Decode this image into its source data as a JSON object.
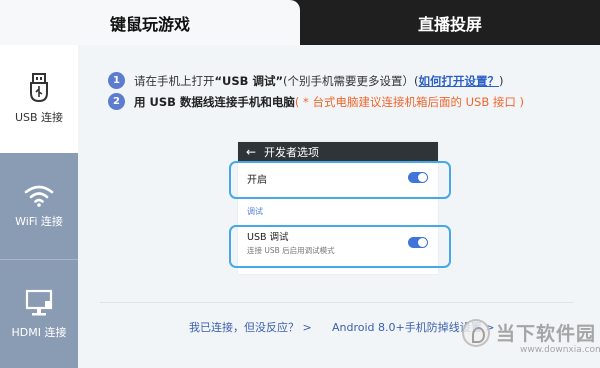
{
  "tabs": {
    "keyboard_mouse": "键鼠玩游戏",
    "screen_cast": "直播投屏"
  },
  "sidebar": {
    "items": [
      {
        "label": "USB 连接",
        "icon": "usb-icon"
      },
      {
        "label": "WiFi 连接",
        "icon": "wifi-icon"
      },
      {
        "label": "HDMI 连接",
        "icon": "monitor-icon"
      }
    ]
  },
  "steps": {
    "step1": {
      "number": "1",
      "text_a": "请在手机上打开",
      "text_b": "“USB 调试”",
      "text_c": "(个别手机需要更多设置）(",
      "link": "如何打开设置？",
      "text_d": ")"
    },
    "step2": {
      "number": "2",
      "text_a": "用 USB 数据线连接手机和电脑",
      "text_b": "( * 台式电脑建议连接机箱后面的 USB 接口 )"
    }
  },
  "phone": {
    "back_glyph": "←",
    "title": "开发者选项",
    "row_on_label": "开启",
    "section_label": "调试",
    "usb_title": "USB 调试",
    "usb_subtitle": "连接 USB 后启用调试模式"
  },
  "footer": {
    "link1": "我已连接，但没反应？ >",
    "link2": "Android 8.0+手机防掉线设置 >"
  },
  "watermark": {
    "text": "当下软件园",
    "url": "www.downxia.com"
  },
  "colors": {
    "accent": "#3f74d8",
    "highlight": "#46a8e6",
    "warning": "#f0662d",
    "sidebar_inactive": "#8a9bb4",
    "tab_bar": "#1f1f1f"
  }
}
